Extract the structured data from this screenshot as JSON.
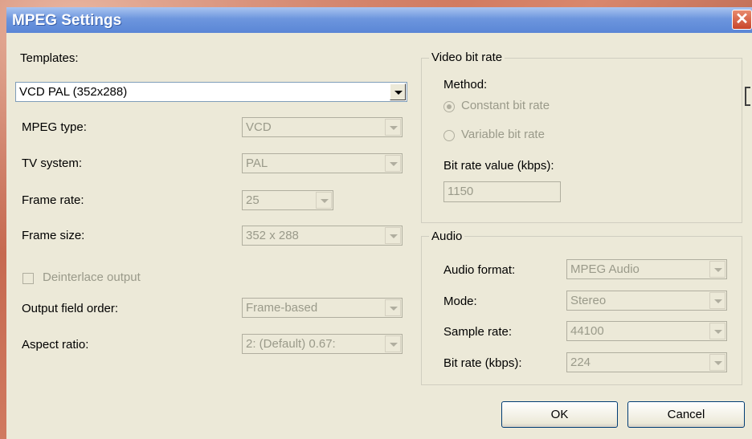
{
  "window": {
    "title": "MPEG Settings",
    "close_glyph": "✕"
  },
  "templates": {
    "label": "Templates:",
    "value": "VCD PAL (352x288)"
  },
  "mpeg_type": {
    "label": "MPEG type:",
    "value": "VCD"
  },
  "tv_system": {
    "label": "TV system:",
    "value": "PAL"
  },
  "frame_rate": {
    "label": "Frame rate:",
    "value": "25"
  },
  "frame_size": {
    "label": "Frame size:",
    "value": "352 x 288"
  },
  "deinterlace": {
    "label": "Deinterlace output",
    "checked": false
  },
  "output_field_order": {
    "label": "Output field order:",
    "value": "Frame-based"
  },
  "aspect_ratio": {
    "label": "Aspect ratio:",
    "value": "2: (Default) 0.67:"
  },
  "video_bit_rate": {
    "group_title": "Video bit rate",
    "method_label": "Method:",
    "constant_label": "Constant bit rate",
    "variable_label": "Variable bit rate",
    "selected_method": "Constant bit rate",
    "value_label": "Bit rate value (kbps):",
    "value": "1150"
  },
  "audio": {
    "group_title": "Audio",
    "format_label": "Audio format:",
    "format_value": "MPEG Audio",
    "mode_label": "Mode:",
    "mode_value": "Stereo",
    "sample_rate_label": "Sample rate:",
    "sample_rate_value": "44100",
    "bit_rate_label": "Bit rate (kbps):",
    "bit_rate_value": "224"
  },
  "buttons": {
    "ok": "OK",
    "cancel": "Cancel"
  },
  "colors": {
    "titlebar": "#6d96de",
    "dialog_bg": "#ece9d8",
    "disabled_text": "#9a9a8a",
    "close_button": "#c8452b"
  }
}
